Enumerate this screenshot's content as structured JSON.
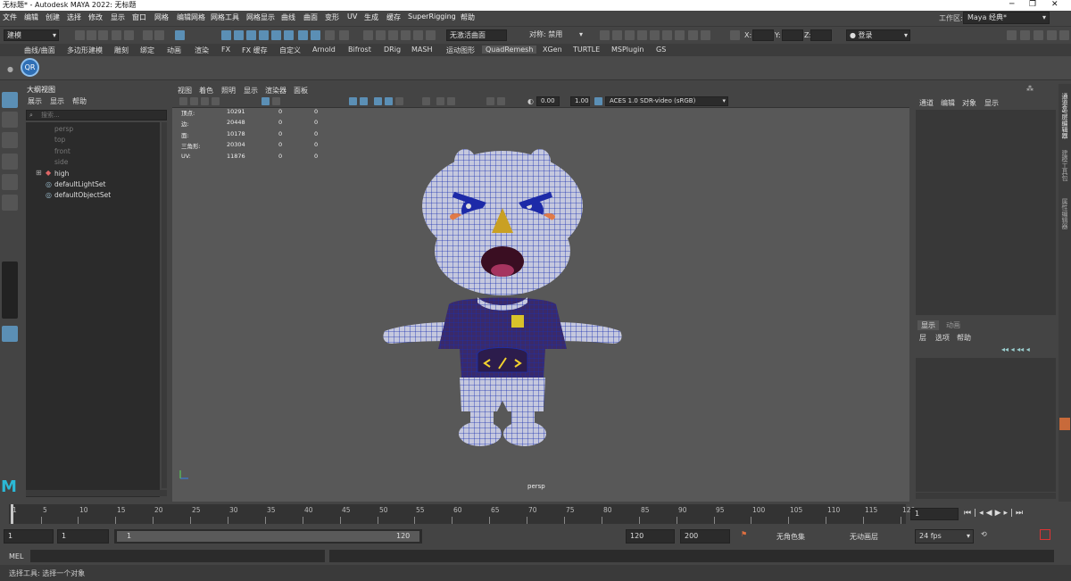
{
  "window": {
    "title": "无标题* - Autodesk MAYA 2022: 无标题"
  },
  "menubar": {
    "items": [
      "文件",
      "编辑",
      "创建",
      "选择",
      "修改",
      "显示",
      "窗口",
      "网格",
      "编辑网格",
      "网格工具",
      "网格显示",
      "曲线",
      "曲面",
      "变形",
      "UV",
      "生成",
      "缓存",
      "SuperRigging",
      "帮助"
    ],
    "workspace_label": "工作区:",
    "workspace_value": "Maya 经典*"
  },
  "statusline": {
    "mode_menu": "建模",
    "live_surface": "无激活曲面",
    "symmetry": "对称: 禁用",
    "x_label": "X:",
    "y_label": "Y:",
    "z_label": "Z:",
    "login": "登录"
  },
  "shelf": {
    "tabs": [
      "曲线/曲面",
      "多边形建模",
      "雕刻",
      "绑定",
      "动画",
      "渲染",
      "FX",
      "FX 缓存",
      "自定义",
      "Arnold",
      "Bifrost",
      "DRig",
      "MASH",
      "运动图形",
      "QuadRemesh",
      "XGen",
      "TURTLE",
      "MSPlugin",
      "GS"
    ],
    "active_tab": "QuadRemesh",
    "button_label": "QR"
  },
  "outliner": {
    "title": "大纲视图",
    "menu": [
      "展示",
      "显示",
      "帮助"
    ],
    "search_placeholder": "搜索...",
    "items": [
      {
        "label": "persp",
        "dim": true
      },
      {
        "label": "top",
        "dim": true
      },
      {
        "label": "front",
        "dim": true
      },
      {
        "label": "side",
        "dim": true
      },
      {
        "label": "high",
        "dim": false
      },
      {
        "label": "defaultLightSet",
        "dim": false
      },
      {
        "label": "defaultObjectSet",
        "dim": false
      }
    ]
  },
  "viewport": {
    "menu": [
      "视图",
      "着色",
      "照明",
      "显示",
      "渲染器",
      "面板"
    ],
    "exposure": "0.00",
    "gamma": "1.00",
    "colorspace": "ACES 1.0 SDR-video (sRGB)",
    "camera_label": "persp",
    "hud": [
      {
        "label": "顶点:",
        "v1": "10291",
        "v2": "0",
        "v3": "0"
      },
      {
        "label": "边:",
        "v1": "20448",
        "v2": "0",
        "v3": "0"
      },
      {
        "label": "面:",
        "v1": "10178",
        "v2": "0",
        "v3": "0"
      },
      {
        "label": "三角形:",
        "v1": "20304",
        "v2": "0",
        "v3": "0"
      },
      {
        "label": "UV:",
        "v1": "11876",
        "v2": "0",
        "v3": "0"
      }
    ]
  },
  "channelbox": {
    "menu": [
      "通道",
      "编辑",
      "对象",
      "显示"
    ],
    "layer_tabs": [
      "显示",
      "动画"
    ],
    "layer_menu": [
      "层",
      "选项",
      "帮助"
    ]
  },
  "sidetabs": [
    "通道盒/层编辑器",
    "建模工具包",
    "属性编辑器"
  ],
  "timeline": {
    "ticks": [
      "1",
      "5",
      "10",
      "15",
      "20",
      "25",
      "30",
      "35",
      "40",
      "45",
      "50",
      "55",
      "60",
      "65",
      "70",
      "75",
      "80",
      "85",
      "90",
      "95",
      "100",
      "105",
      "110",
      "115",
      "120"
    ],
    "current_frame": "1"
  },
  "range": {
    "start": "1",
    "start2": "1",
    "slider_start": "1",
    "slider_end": "120",
    "end": "120",
    "end2": "200",
    "char_set": "无角色集",
    "anim_layer": "无动画层",
    "fps": "24 fps"
  },
  "cmdline": {
    "label": "MEL"
  },
  "helpline": {
    "text": "选择工具: 选择一个对象"
  },
  "colors": {
    "accent": "#5b8fb5",
    "wire": "#1a2fb0",
    "model": "#c5c8de"
  }
}
